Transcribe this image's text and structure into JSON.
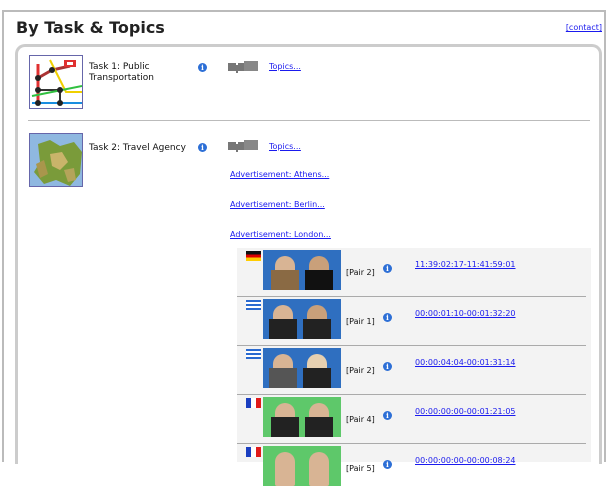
{
  "header": {
    "title": "By Task & Topics",
    "contact": "[contact]"
  },
  "tasks": [
    {
      "label": "Task 1: Public\nTransportation",
      "topics": "Topics..."
    },
    {
      "label": "Task 2: Travel Agency",
      "topics": "Topics..."
    }
  ],
  "advertisements": [
    "Advertisement: Athens...",
    "Advertisement: Berlin...",
    "Advertisement: London..."
  ],
  "pairs": [
    {
      "flag": "germany",
      "label": "[Pair 2]",
      "timecode": "11:39:02:17-11:41:59:01",
      "bg": "blue"
    },
    {
      "flag": "greece",
      "label": "[Pair 1]",
      "timecode": "00:00:01:10-00:01:32:20",
      "bg": "blue"
    },
    {
      "flag": "greece",
      "label": "[Pair 2]",
      "timecode": "00:00:04:04-00:01:31:14",
      "bg": "blue"
    },
    {
      "flag": "france",
      "label": "[Pair 4]",
      "timecode": "00:00:00:00-00:01:21:05",
      "bg": "green"
    },
    {
      "flag": "france",
      "label": "[Pair 5]",
      "timecode": "00:00:00:00-00:00:08:24",
      "bg": "green"
    }
  ],
  "icons": {
    "info": "info-icon",
    "topics": "puzzle-icon"
  }
}
